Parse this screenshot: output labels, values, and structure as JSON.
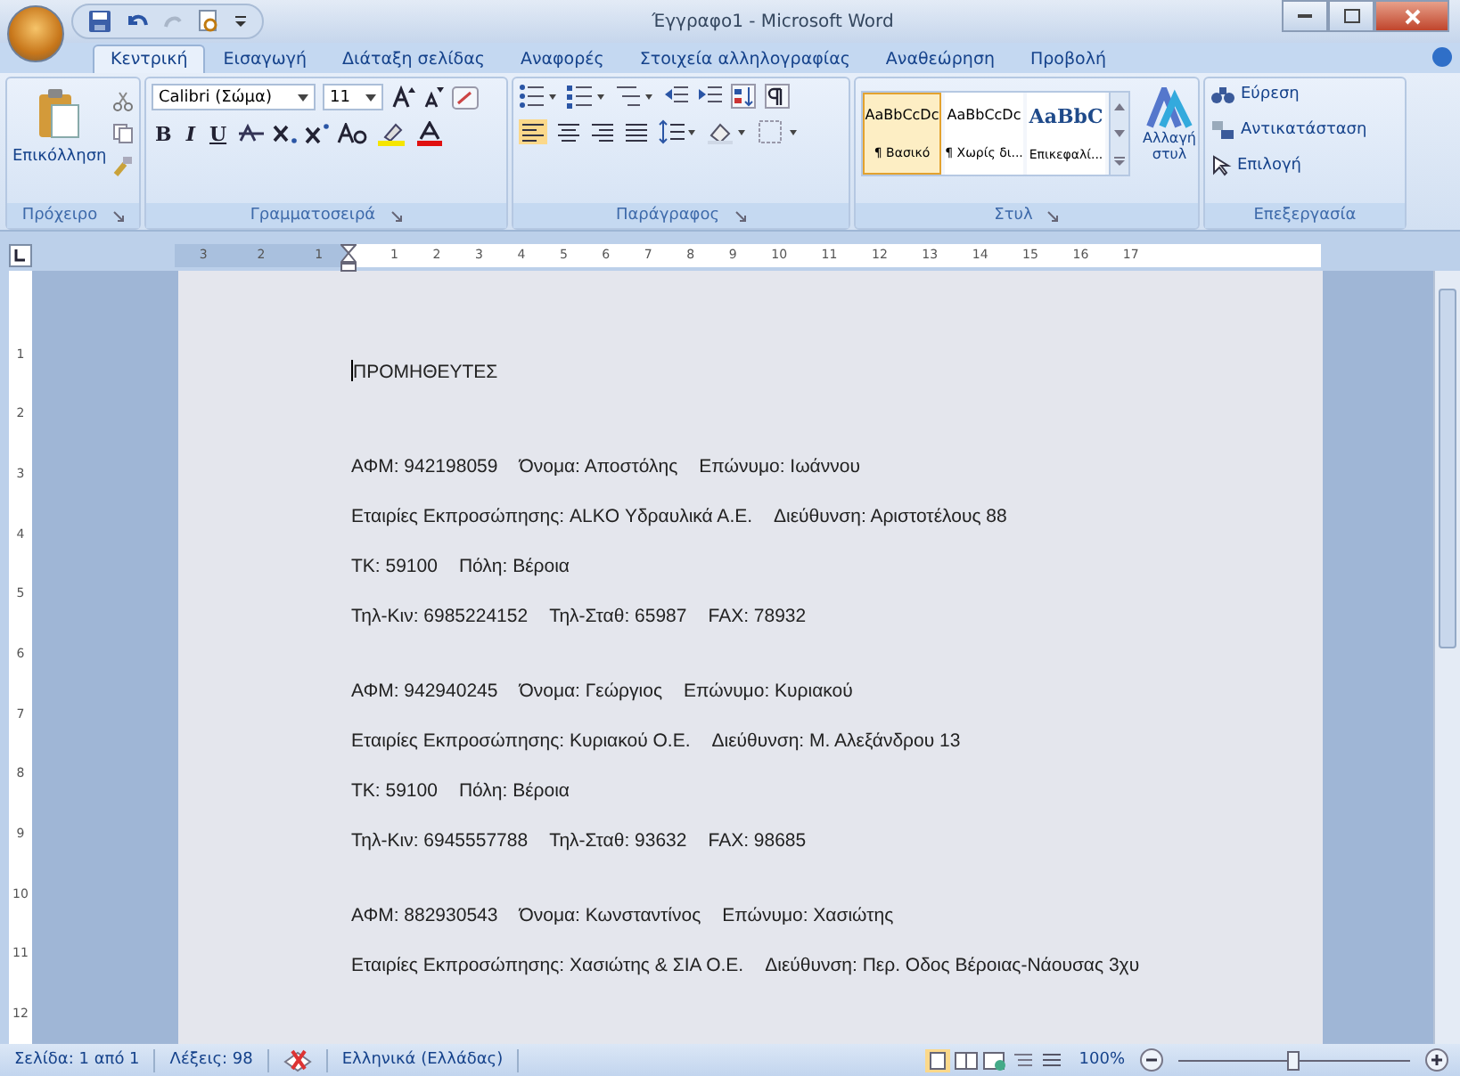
{
  "window": {
    "title": "Έγγραφο1 - Microsoft Word"
  },
  "tabs": [
    {
      "label": "Κεντρική",
      "selected": true
    },
    {
      "label": "Εισαγωγή",
      "selected": false
    },
    {
      "label": "Διάταξη σελίδας",
      "selected": false
    },
    {
      "label": "Αναφορές",
      "selected": false
    },
    {
      "label": "Στοιχεία αλληλογραφίας",
      "selected": false
    },
    {
      "label": "Αναθεώρηση",
      "selected": false
    },
    {
      "label": "Προβολή",
      "selected": false
    }
  ],
  "ribbon": {
    "clipboard": {
      "paste_label": "Επικόλληση",
      "group_label": "Πρόχειρο"
    },
    "font": {
      "name": "Calibri (Σώμα)",
      "size": "11",
      "buttons": [
        "B",
        "I",
        "U"
      ],
      "group_label": "Γραμματοσειρά"
    },
    "paragraph": {
      "group_label": "Παράγραφος"
    },
    "styles": {
      "items": [
        {
          "preview": "AaBbCcDc",
          "label": "¶ Βασικό",
          "kind": "normal",
          "selected": true
        },
        {
          "preview": "AaBbCcDc",
          "label": "¶ Χωρίς δι...",
          "kind": "normal",
          "selected": false
        },
        {
          "preview": "AaBbC",
          "label": "Επικεφαλί...",
          "kind": "heading",
          "selected": false
        }
      ],
      "change_label": "Αλλαγή στυλ",
      "group_label": "Στυλ"
    },
    "editing": {
      "items": [
        "Εύρεση",
        "Αντικατάσταση",
        "Επιλογή"
      ],
      "group_label": "Επεξεργασία"
    }
  },
  "ruler": {
    "left_labels": [
      "3",
      "2",
      "1"
    ],
    "labels": [
      "1",
      "2",
      "3",
      "4",
      "5",
      "6",
      "7",
      "8",
      "9",
      "10",
      "11",
      "12",
      "13",
      "14",
      "15",
      "16",
      "17"
    ],
    "vertical_labels": [
      "1",
      "2",
      "3",
      "4",
      "5",
      "6",
      "7",
      "8",
      "9",
      "10",
      "11",
      "12"
    ]
  },
  "document": {
    "heading": "ΠΡΟΜΗΘΕΥΤΕΣ",
    "records": [
      {
        "lines": [
          [
            "ΑΦΜ: 942198059",
            "Όνομα: Αποστόλης",
            "Επώνυμο: Ιωάννου"
          ],
          [
            "Εταιρίες Εκπροσώπησης: ALKO Υδραυλικά Α.Ε.",
            "Διεύθυνση: Αριστοτέλους 88"
          ],
          [
            "ΤΚ: 59100",
            "Πόλη: Βέροια"
          ],
          [
            "Τηλ-Κιν: 6985224152",
            "Τηλ-Σταθ: 65987",
            "FAX: 78932"
          ]
        ]
      },
      {
        "lines": [
          [
            "ΑΦΜ: 942940245",
            "Όνομα: Γεώργιος",
            "Επώνυμο: Κυριακού"
          ],
          [
            "Εταιρίες Εκπροσώπησης: Κυριακού Ο.Ε.",
            "Διεύθυνση: Μ. Αλεξάνδρου 13"
          ],
          [
            "ΤΚ: 59100",
            "Πόλη: Βέροια"
          ],
          [
            "Τηλ-Κιν: 6945557788",
            "Τηλ-Σταθ: 93632",
            "FAX: 98685"
          ]
        ]
      },
      {
        "lines": [
          [
            "ΑΦΜ: 882930543",
            "Όνομα: Κωνσταντίνος",
            "Επώνυμο: Χασιώτης"
          ],
          [
            "Εταιρίες Εκπροσώπησης: Χασιώτης & ΣΙΑ Ο.Ε.",
            "Διεύθυνση: Περ. Οδος Βέροιας-Νάουσας 3χυ"
          ]
        ]
      }
    ]
  },
  "status_bar": {
    "page": "Σελίδα: 1 από 1",
    "words": "Λέξεις: 98",
    "language": "Ελληνικά (Ελλάδας)",
    "zoom": "100%",
    "zoom_slider": {
      "level": 0.5
    }
  }
}
